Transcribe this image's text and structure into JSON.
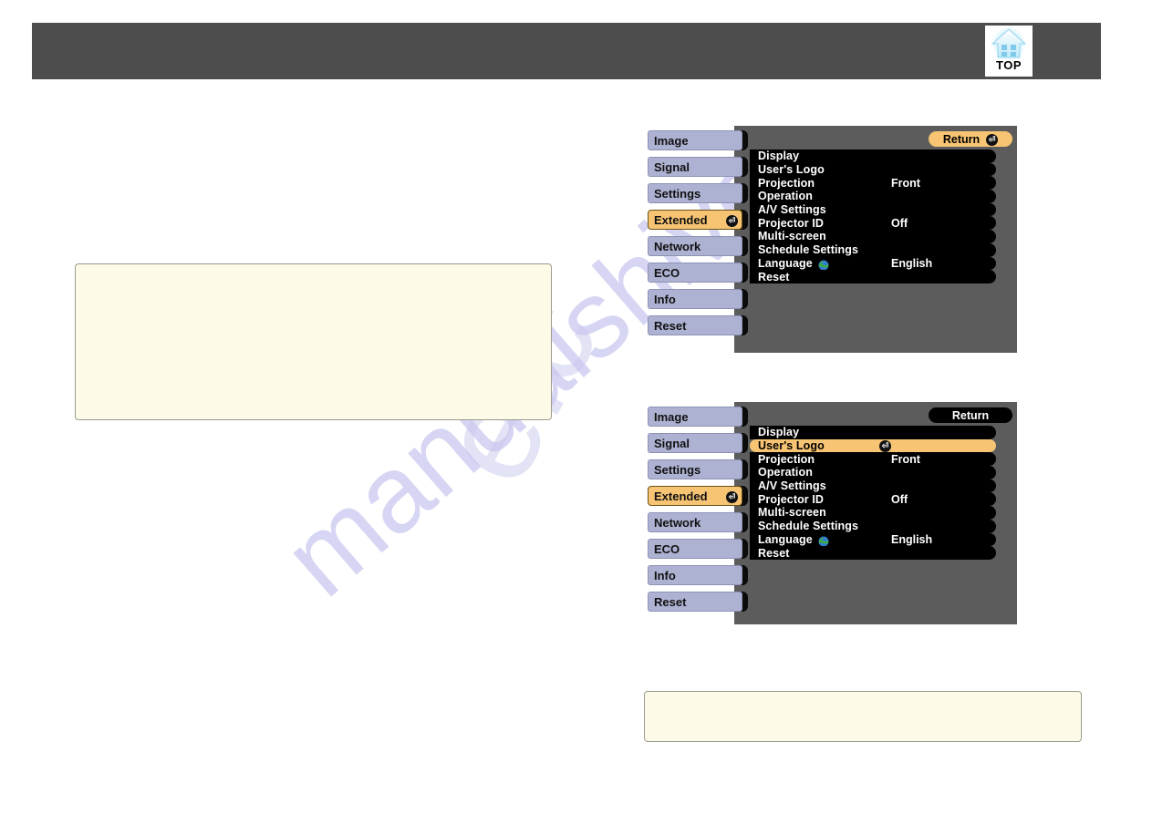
{
  "page": {
    "watermark_primary": "manualshive",
    "watermark_secondary": "e.c"
  },
  "header": {
    "top_button": {
      "label": "TOP",
      "icon": "home-icon"
    }
  },
  "note_boxes": [
    {
      "id": "note-box-1",
      "text": ""
    },
    {
      "id": "note-box-2",
      "text": ""
    }
  ],
  "osd_menus": [
    {
      "id": "osd-1",
      "tabs": [
        {
          "label": "Image",
          "selected": false,
          "enter_icon": false
        },
        {
          "label": "Signal",
          "selected": false,
          "enter_icon": false
        },
        {
          "label": "Settings",
          "selected": false,
          "enter_icon": false
        },
        {
          "label": "Extended",
          "selected": true,
          "enter_icon": true
        },
        {
          "label": "Network",
          "selected": false,
          "enter_icon": false
        },
        {
          "label": "ECO",
          "selected": false,
          "enter_icon": false
        },
        {
          "label": "Info",
          "selected": false,
          "enter_icon": false
        },
        {
          "label": "Reset",
          "selected": false,
          "enter_icon": false
        }
      ],
      "return_button": {
        "label": "Return",
        "accent": true,
        "enter_icon": true
      },
      "rows": [
        {
          "label": "Display",
          "value": "",
          "highlighted": false,
          "enter_icon": false,
          "globe": false
        },
        {
          "label": "User's Logo",
          "value": "",
          "highlighted": false,
          "enter_icon": false,
          "globe": false
        },
        {
          "label": "Projection",
          "value": "Front",
          "highlighted": false,
          "enter_icon": false,
          "globe": false
        },
        {
          "label": "Operation",
          "value": "",
          "highlighted": false,
          "enter_icon": false,
          "globe": false
        },
        {
          "label": "A/V Settings",
          "value": "",
          "highlighted": false,
          "enter_icon": false,
          "globe": false
        },
        {
          "label": "Projector ID",
          "value": "Off",
          "highlighted": false,
          "enter_icon": false,
          "globe": false
        },
        {
          "label": "Multi-screen",
          "value": "",
          "highlighted": false,
          "enter_icon": false,
          "globe": false
        },
        {
          "label": "Schedule Settings",
          "value": "",
          "highlighted": false,
          "enter_icon": false,
          "globe": false
        },
        {
          "label": "Language",
          "value": "English",
          "highlighted": false,
          "enter_icon": false,
          "globe": true
        },
        {
          "label": "Reset",
          "value": "",
          "highlighted": false,
          "enter_icon": false,
          "globe": false
        }
      ]
    },
    {
      "id": "osd-2",
      "tabs": [
        {
          "label": "Image",
          "selected": false,
          "enter_icon": false
        },
        {
          "label": "Signal",
          "selected": false,
          "enter_icon": false
        },
        {
          "label": "Settings",
          "selected": false,
          "enter_icon": false
        },
        {
          "label": "Extended",
          "selected": true,
          "enter_icon": true
        },
        {
          "label": "Network",
          "selected": false,
          "enter_icon": false
        },
        {
          "label": "ECO",
          "selected": false,
          "enter_icon": false
        },
        {
          "label": "Info",
          "selected": false,
          "enter_icon": false
        },
        {
          "label": "Reset",
          "selected": false,
          "enter_icon": false
        }
      ],
      "return_button": {
        "label": "Return",
        "accent": false,
        "enter_icon": false
      },
      "rows": [
        {
          "label": "Display",
          "value": "",
          "highlighted": false,
          "enter_icon": false,
          "globe": false
        },
        {
          "label": "User's Logo",
          "value": "",
          "highlighted": true,
          "enter_icon": true,
          "globe": false
        },
        {
          "label": "Projection",
          "value": "Front",
          "highlighted": false,
          "enter_icon": false,
          "globe": false
        },
        {
          "label": "Operation",
          "value": "",
          "highlighted": false,
          "enter_icon": false,
          "globe": false
        },
        {
          "label": "A/V Settings",
          "value": "",
          "highlighted": false,
          "enter_icon": false,
          "globe": false
        },
        {
          "label": "Projector ID",
          "value": "Off",
          "highlighted": false,
          "enter_icon": false,
          "globe": false
        },
        {
          "label": "Multi-screen",
          "value": "",
          "highlighted": false,
          "enter_icon": false,
          "globe": false
        },
        {
          "label": "Schedule Settings",
          "value": "",
          "highlighted": false,
          "enter_icon": false,
          "globe": false
        },
        {
          "label": "Language",
          "value": "English",
          "highlighted": false,
          "enter_icon": false,
          "globe": true
        },
        {
          "label": "Reset",
          "value": "",
          "highlighted": false,
          "enter_icon": false,
          "globe": false
        }
      ]
    }
  ],
  "colors": {
    "header_bar": "#4d4d4d",
    "osd_panel": "#5c5c5c",
    "osd_row": "#000000",
    "accent_orange": "#f6c473",
    "tab_blue": "#aeb2d2",
    "note_cream": "#fdfbe8",
    "watermark": "#c9c8ef"
  }
}
